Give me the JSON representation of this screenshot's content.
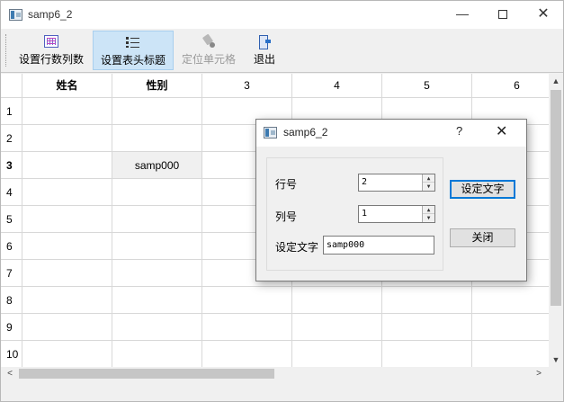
{
  "window": {
    "title": "samp6_2",
    "minimize_glyph": "—",
    "close_glyph": "✕"
  },
  "toolbar": {
    "items": [
      {
        "label": "设置行数列数",
        "icon": "grid-icon",
        "active": false,
        "enabled": true
      },
      {
        "label": "设置表头标题",
        "icon": "list-icon",
        "active": true,
        "enabled": true
      },
      {
        "label": "定位单元格",
        "icon": "locate-icon",
        "active": false,
        "enabled": false
      },
      {
        "label": "退出",
        "icon": "exit-icon",
        "active": false,
        "enabled": true
      }
    ]
  },
  "table": {
    "headers": [
      "姓名",
      "性别",
      "3",
      "4",
      "5",
      "6"
    ],
    "row_labels": [
      "1",
      "2",
      "3",
      "4",
      "5",
      "6",
      "7",
      "8",
      "9",
      "10"
    ],
    "cells": {
      "r3_c2": "samp000"
    },
    "selected_row": "3"
  },
  "dialog": {
    "title": "samp6_2",
    "help_glyph": "?",
    "close_glyph": "✕",
    "row_label": "行号",
    "row_value": "2",
    "col_label": "列号",
    "col_value": "1",
    "text_label": "设定文字",
    "text_value": "samp000",
    "set_button": "设定文字",
    "close_button": "关闭"
  }
}
